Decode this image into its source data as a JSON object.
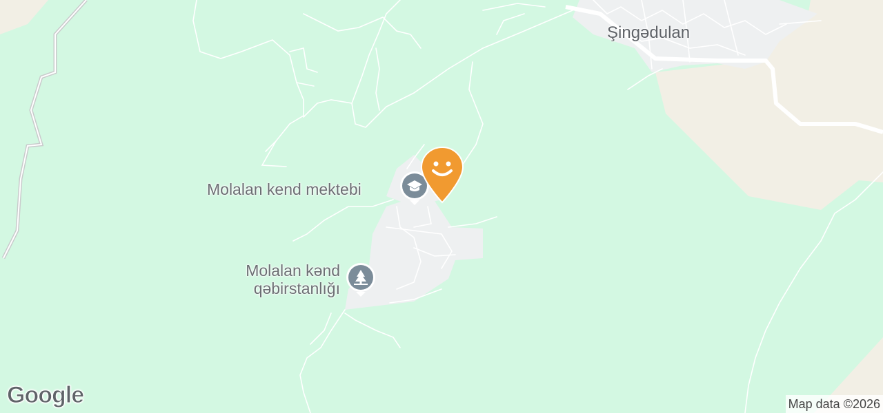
{
  "map": {
    "places": {
      "town": "Şingədulan"
    },
    "pois": {
      "school": {
        "name": "Molalan kend mektebi",
        "icon": "graduation-cap-icon"
      },
      "cemetery": {
        "name_line1": "Molalan kənd",
        "name_line2": "qəbirstanlığı",
        "icon": "cemetery-tree-icon"
      }
    },
    "marker": {
      "icon": "smiley-face-icon",
      "color": "#f19a30"
    },
    "colors": {
      "land": "#d3f8e2",
      "urban": "#f1f3f4",
      "sand": "#f1efe6",
      "road": "#ffffff",
      "poi_badge": "#7b8c99"
    }
  },
  "branding": {
    "logo": "Google",
    "attribution": "Map data ©2026"
  }
}
